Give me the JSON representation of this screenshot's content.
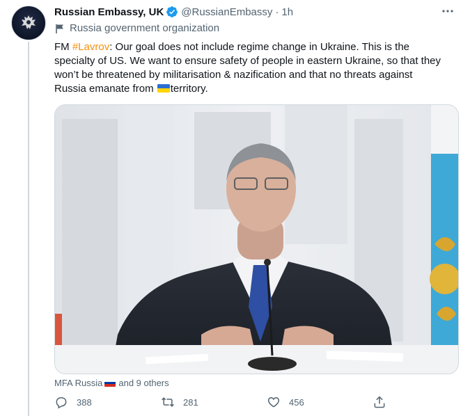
{
  "account": {
    "name": "Russian Embassy, UK",
    "handle": "@RussianEmbassy",
    "separator": "·",
    "time": "1h",
    "label": "Russia government organization"
  },
  "tweet": {
    "prefix": "FM ",
    "hashtag": "#Lavrov",
    "body": ": Our goal does not include regime change in Ukraine. This is the specialty of US. We want to ensure safety of people in eastern Ukraine, so that they won’t be threatened by militarisation & nazification and that no threats against Russia emanate from ",
    "flag_icon": "ukraine-flag-emoji",
    "suffix": "territory."
  },
  "media": {
    "description_icon": "photo"
  },
  "tagged": {
    "first": "MFA Russia",
    "flag_icon": "russia-flag-emoji",
    "rest": "and 9 others"
  },
  "actions": {
    "replies": "388",
    "retweets": "281",
    "likes": "456"
  },
  "colors": {
    "hashtag": "#f4900c",
    "verified": "#1d9bf0",
    "muted": "#536471"
  }
}
